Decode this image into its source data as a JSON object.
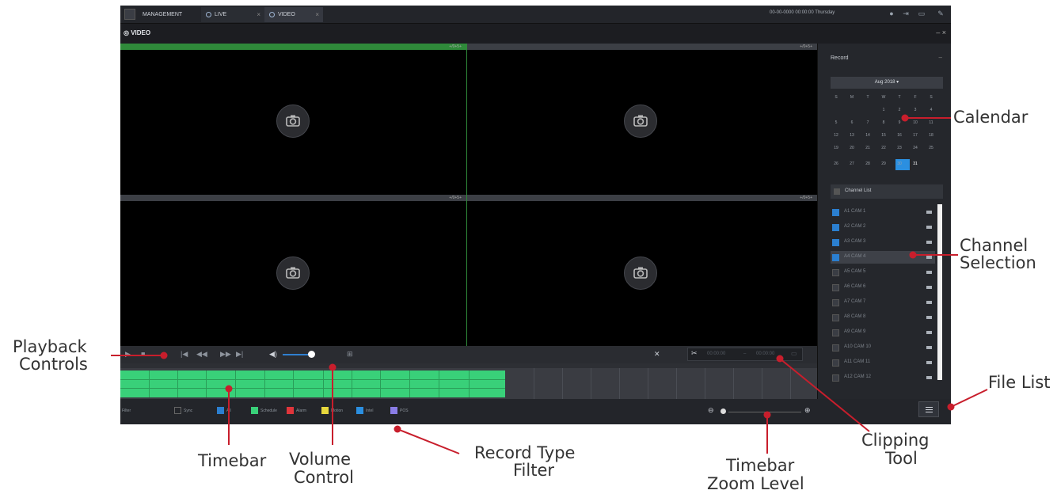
{
  "topbar": {
    "tabs": [
      {
        "label": "MANAGEMENT"
      },
      {
        "label": "LIVE",
        "close": "×"
      },
      {
        "label": "VIDEO",
        "close": "×"
      }
    ],
    "clock": "00-00-0000 00:00:00 Thursday"
  },
  "window": {
    "title": "VIDEO",
    "controls": "– ×"
  },
  "pane_label": "+/0+5+",
  "side": {
    "record_label": "Record",
    "month": "Aug 2018",
    "weekdays": [
      "S",
      "M",
      "T",
      "W",
      "T",
      "F",
      "S"
    ],
    "weeks": [
      [
        "",
        "",
        "",
        "1",
        "2",
        "3",
        "4"
      ],
      [
        "5",
        "6",
        "7",
        "8",
        "9",
        "10",
        "11"
      ],
      [
        "12",
        "13",
        "14",
        "15",
        "16",
        "17",
        "18"
      ],
      [
        "19",
        "20",
        "21",
        "22",
        "23",
        "24",
        "25"
      ],
      [
        "26",
        "27",
        "28",
        "29",
        "30",
        "31",
        ""
      ]
    ],
    "selected_day": "30",
    "channel_list_label": "Channel List",
    "channels": [
      {
        "name": "A1 CAM 1",
        "checked": true
      },
      {
        "name": "A2 CAM 2",
        "checked": true
      },
      {
        "name": "A3 CAM 3",
        "checked": true
      },
      {
        "name": "A4 CAM 4",
        "checked": true
      },
      {
        "name": "A5 CAM 5",
        "checked": false
      },
      {
        "name": "A6 CAM 6",
        "checked": false
      },
      {
        "name": "A7 CAM 7",
        "checked": false
      },
      {
        "name": "A8 CAM 8",
        "checked": false
      },
      {
        "name": "A9 CAM 9",
        "checked": false
      },
      {
        "name": "A10 CAM 10",
        "checked": false
      },
      {
        "name": "A11 CAM 11",
        "checked": false
      },
      {
        "name": "A12 CAM 12",
        "checked": false
      }
    ]
  },
  "filters": {
    "label": "Filter",
    "items": [
      "Sync",
      "All",
      "Schedule",
      "Alarm",
      "Motion",
      "Intel",
      "POS"
    ],
    "colors": [
      "#2b7fd0",
      "#39d079",
      "#e0353b",
      "#e7d83d",
      "#2b8fe0",
      "#8a7de6"
    ]
  },
  "clip": {
    "start": "00:00:00",
    "sep": "–",
    "end": "00:00:00"
  },
  "callouts": {
    "calendar": "Calendar",
    "channel_selection_1": "Channel",
    "channel_selection_2": "Selection",
    "playback_1": "Playback",
    "playback_2": "Controls",
    "file_list": "File List",
    "timebar": "Timebar",
    "volume_1": "Volume",
    "volume_2": "Control",
    "record_type_1": "Record Type",
    "record_type_2": "Filter",
    "zoom_1": "Timebar",
    "zoom_2": "Zoom Level",
    "clipping_1": "Clipping",
    "clipping_2": "Tool"
  },
  "accent": "#c81e2c"
}
